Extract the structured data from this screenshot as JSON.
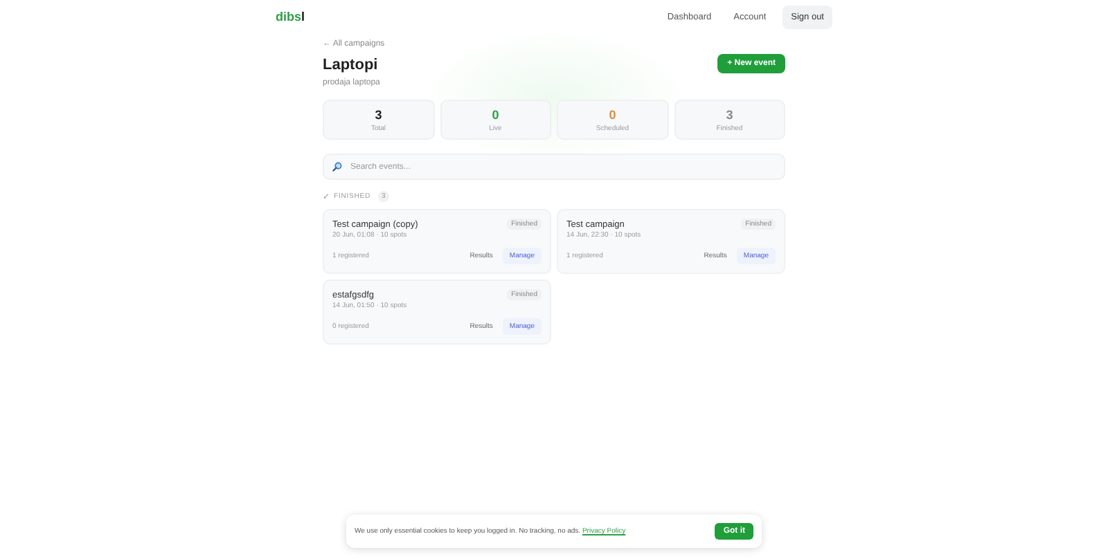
{
  "header": {
    "logo": "dibs",
    "logo_accent": "l",
    "nav": [
      {
        "label": "Dashboard",
        "kind": "link"
      },
      {
        "label": "Account",
        "kind": "link"
      },
      {
        "label": "Sign out",
        "kind": "button"
      }
    ]
  },
  "campaign": {
    "back_link": "← All campaigns",
    "title": "Laptopi",
    "subtitle": "prodaja laptopa",
    "new_button": "+ New event"
  },
  "stats": [
    {
      "value": "3",
      "label": "Total",
      "color": "#222222"
    },
    {
      "value": "0",
      "label": "Live",
      "color": "#2e9e4a"
    },
    {
      "value": "0",
      "label": "Scheduled",
      "color": "#e08a3c"
    },
    {
      "value": "3",
      "label": "Finished",
      "color": "#8a8a8a"
    }
  ],
  "search": {
    "placeholder": "Search events..."
  },
  "section": {
    "check": "✓",
    "title": "FINISHED",
    "count": "3"
  },
  "events": [
    {
      "name": "Test campaign (copy)",
      "status": "Finished",
      "meta": "20 Jun, 01:08 · 10 spots",
      "registered": "1 registered",
      "results": "Results",
      "manage": "Manage"
    },
    {
      "name": "Test campaign",
      "status": "Finished",
      "meta": "14 Jun, 22:30 · 10 spots",
      "registered": "1 registered",
      "results": "Results",
      "manage": "Manage"
    },
    {
      "name": "estafgsdfg",
      "status": "Finished",
      "meta": "14 Jun, 01:50 · 10 spots",
      "registered": "0 registered",
      "results": "Results",
      "manage": "Manage"
    }
  ],
  "cookie_banner": {
    "text": "We use only essential cookies to keep you logged in. No tracking, no ads.",
    "link": "Privacy Policy",
    "button": "Got it"
  }
}
